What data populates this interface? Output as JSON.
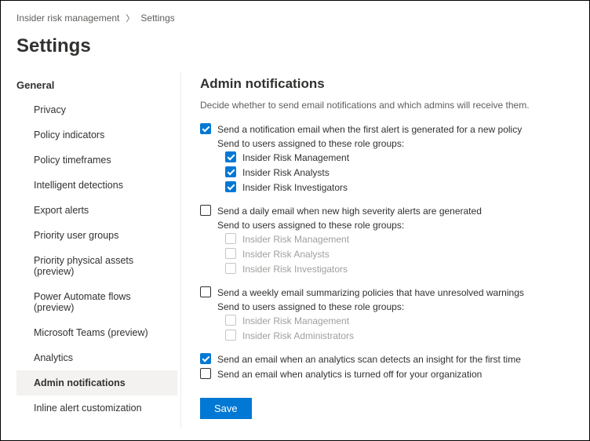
{
  "breadcrumb": {
    "root": "Insider risk management",
    "current": "Settings"
  },
  "pageTitle": "Settings",
  "sidebar": {
    "section": "General",
    "items": [
      "Privacy",
      "Policy indicators",
      "Policy timeframes",
      "Intelligent detections",
      "Export alerts",
      "Priority user groups",
      "Priority physical assets (preview)",
      "Power Automate flows (preview)",
      "Microsoft Teams (preview)",
      "Analytics",
      "Admin notifications",
      "Inline alert customization"
    ],
    "activeIndex": 10
  },
  "main": {
    "heading": "Admin notifications",
    "desc": "Decide whether to send email notifications and which admins will receive them.",
    "sendToLabel": "Send to users assigned to these role groups:",
    "opt1": {
      "label": "Send a notification email when the first alert is generated for a new policy",
      "checked": true,
      "groups": [
        {
          "label": "Insider Risk Management",
          "checked": true
        },
        {
          "label": "Insider Risk Analysts",
          "checked": true
        },
        {
          "label": "Insider Risk Investigators",
          "checked": true
        }
      ]
    },
    "opt2": {
      "label": "Send a daily email when new high severity alerts are generated",
      "checked": false,
      "groups": [
        {
          "label": "Insider Risk Management",
          "checked": false
        },
        {
          "label": "Insider Risk Analysts",
          "checked": false
        },
        {
          "label": "Insider Risk Investigators",
          "checked": false
        }
      ]
    },
    "opt3": {
      "label": "Send a weekly email summarizing policies that have unresolved warnings",
      "checked": false,
      "groups": [
        {
          "label": "Insider Risk Management",
          "checked": false
        },
        {
          "label": "Insider Risk Administrators",
          "checked": false
        }
      ]
    },
    "opt4": {
      "label": "Send an email when an analytics scan detects an insight for the first time",
      "checked": true
    },
    "opt5": {
      "label": "Send an email when analytics is turned off for your organization",
      "checked": false
    },
    "saveLabel": "Save"
  }
}
